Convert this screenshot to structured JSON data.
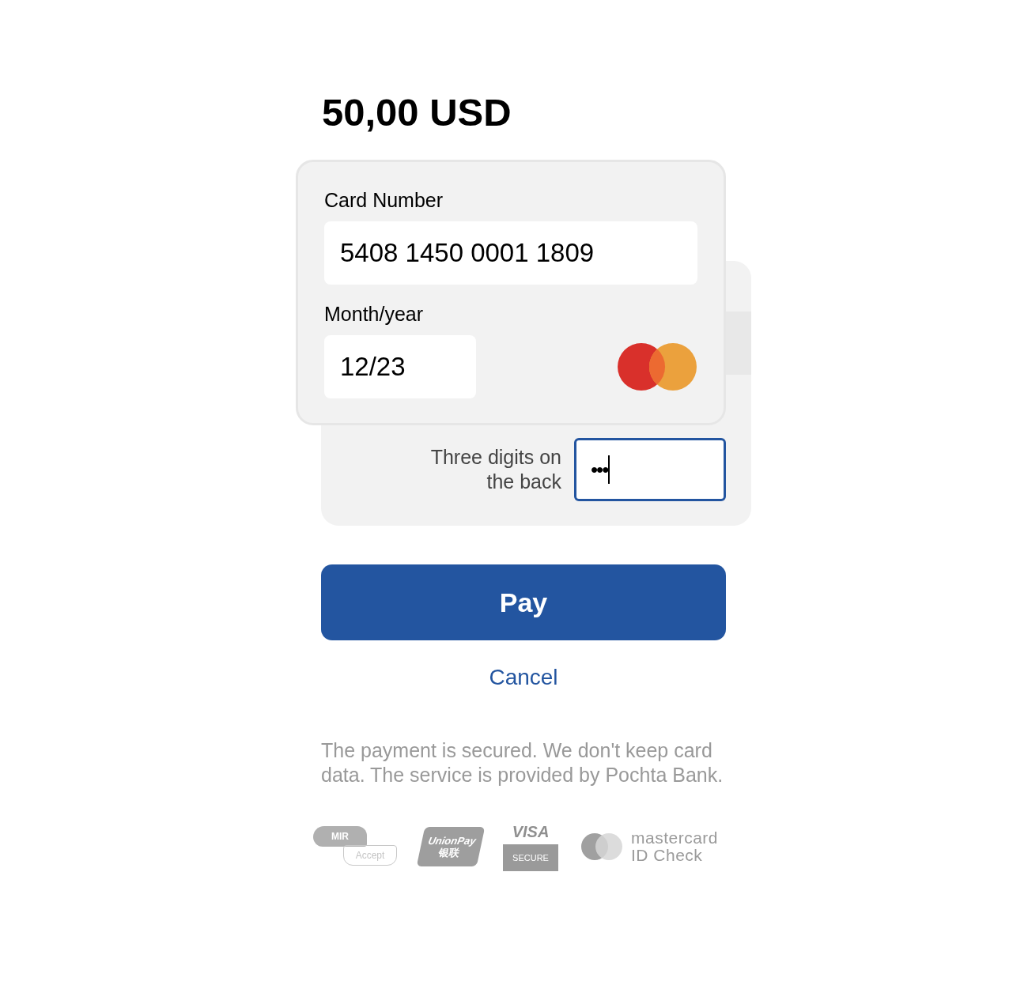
{
  "amount": "50,00 USD",
  "card_front": {
    "card_number": {
      "label": "Card Number",
      "value": "5408 1450 0001 1809"
    },
    "expiry": {
      "label": "Month/year",
      "value": "12/23"
    }
  },
  "card_back": {
    "cvv": {
      "label": "Three digits on the back",
      "value": "•••",
      "focused": true
    }
  },
  "pay_button": "Pay",
  "cancel_link": "Cancel",
  "security_note": "The payment is secured. We don't keep card data. The service is provided by Pochta Bank.",
  "payment_logos": [
    {
      "kind": "mir",
      "texts": [
        "MIR",
        "Accept"
      ]
    },
    {
      "kind": "unionpay",
      "texts": [
        "UnionPay",
        "银联"
      ]
    },
    {
      "kind": "visa",
      "texts": [
        "VISA",
        "SECURE"
      ]
    },
    {
      "kind": "mastercard",
      "texts": [
        "mastercard",
        "ID Check"
      ]
    }
  ]
}
